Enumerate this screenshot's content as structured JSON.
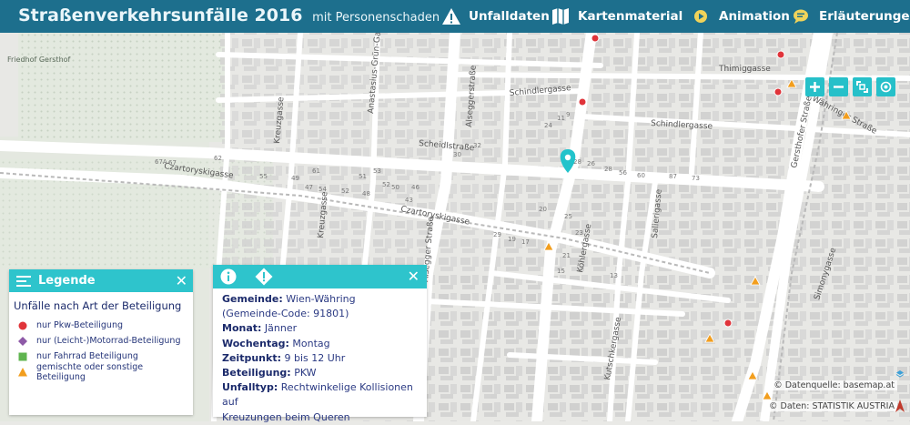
{
  "header": {
    "title": "Straßenverkehrsunfälle 2016",
    "subtitle": "mit Personenschaden",
    "nav": [
      {
        "label": "Unfalldaten",
        "icon": "warning-icon"
      },
      {
        "label": "Kartenmaterial",
        "icon": "map-icon"
      },
      {
        "label": "Animation",
        "icon": "play-icon"
      },
      {
        "label": "Erläuterungen",
        "icon": "speech-bubble-icon"
      }
    ]
  },
  "map": {
    "streets": [
      "Czartoryskigasse",
      "Czartoryskigasse",
      "Scheidlstraße",
      "Schindlergasse",
      "Schindlergasse",
      "Thimiggasse",
      "Gersthofer Straße",
      "Währinger Straße",
      "Alseggerstraße",
      "Alsegger Straße",
      "Kreuzgasse",
      "Salierigasse",
      "Simonygasse",
      "Kutschkergasse",
      "Anastasius-Grün-Gasse",
      "Köhlergasse",
      "Kreuzgasse"
    ],
    "place_labels": [
      "Friedhof Gersthof"
    ],
    "house_numbers": [
      "62",
      "52",
      "48",
      "54",
      "61",
      "30",
      "29",
      "19",
      "17",
      "43",
      "67A",
      "67",
      "55",
      "49",
      "47",
      "32",
      "26",
      "28",
      "25",
      "23",
      "21",
      "20",
      "15",
      "13",
      "28",
      "24",
      "11",
      "9",
      "51",
      "53",
      "56",
      "60",
      "87",
      "73",
      "52",
      "50",
      "46"
    ],
    "zoom_controls": [
      "zoom-in",
      "zoom-out",
      "fullscreen",
      "locate"
    ],
    "selected_marker": "selected-location-icon"
  },
  "legend": {
    "title": "Legende",
    "section": "Unfälle nach Art der Beteiligung",
    "items": [
      {
        "label": "nur Pkw-Beteiligung",
        "shape": "circle",
        "color": "#e0343a"
      },
      {
        "label": "nur (Leicht-)Motorrad-Beteiligung",
        "shape": "diamond",
        "color": "#8e5aa7"
      },
      {
        "label": "nur Fahrrad Beteiligung",
        "shape": "square",
        "color": "#5fb44f"
      },
      {
        "label": "gemischte oder sonstige Beteiligung",
        "shape": "triangle",
        "color": "#f29e1e"
      }
    ]
  },
  "info": {
    "rows": [
      {
        "label": "Gemeinde:",
        "value": "Wien-Währing"
      },
      {
        "label": "",
        "value": "(Gemeinde-Code: 91801)"
      },
      {
        "label": "Monat:",
        "value": "Jänner"
      },
      {
        "label": "Wochentag:",
        "value": "Montag"
      },
      {
        "label": "Zeitpunkt:",
        "value": "9 bis 12 Uhr"
      },
      {
        "label": "Beteiligung:",
        "value": "PKW"
      },
      {
        "label": "Unfalltyp:",
        "value": "Rechtwinkelige Kollisionen auf"
      },
      {
        "label": "",
        "value": "Kreuzungen beim Queren"
      }
    ]
  },
  "attribution": {
    "basemap": "© Datenquelle: basemap.at",
    "data": "© Daten: STATISTIK AUSTRIA"
  },
  "colors": {
    "header": "#1d6f8d",
    "accent": "#2ec4cc",
    "road": "#ffffff",
    "building": "#d3d3d3",
    "background": "#e9e9e6"
  }
}
